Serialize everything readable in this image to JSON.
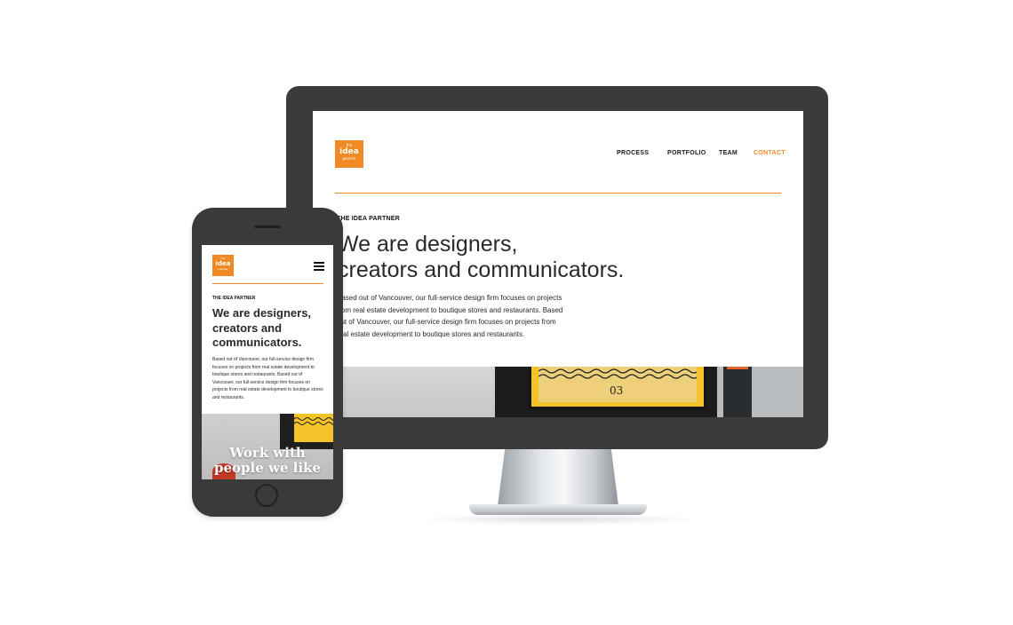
{
  "brand": {
    "logo_top": "the",
    "logo_main": "idea",
    "logo_bottom": "partner",
    "accent_color": "#f08a24"
  },
  "desktop": {
    "nav": {
      "items": [
        "PROCESS",
        "PORTFOLIO",
        "TEAM",
        "CONTACT"
      ],
      "active": "CONTACT"
    },
    "eyebrow": "THE IDEA PARTNER",
    "headline_line1": "We are designers,",
    "headline_line2": "creators and communicators.",
    "body": "Based out of Vancouver, our full-service design firm focuses on projects from real estate development to boutique stores and restaurants. Based out of Vancouver, our full-service design firm focuses on projects from real estate development to boutique stores and restaurants.",
    "poster_number": "03"
  },
  "mobile": {
    "menu_icon": "hamburger-icon",
    "eyebrow": "THE IDEA PARTNER",
    "headline": "We are designers, creators and communicators.",
    "body": "Based out of Vancouver, our full-service design firm focuses on projects from real estate development to boutique stores and restaurants. Based out of Vancouver, our full-service design firm focuses on projects from real estate development to boutique stores and restaurants.",
    "hero_line1": "Work with",
    "hero_line2": "people we like"
  }
}
